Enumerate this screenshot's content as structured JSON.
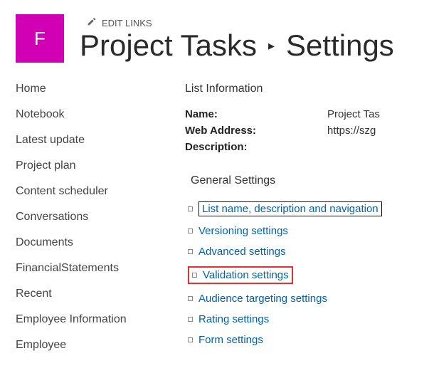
{
  "site": {
    "initial": "F"
  },
  "header": {
    "edit_links_label": "EDIT LINKS",
    "title_part1": "Project Tasks",
    "title_part2": "Settings"
  },
  "sidebar": {
    "items": [
      {
        "label": "Home"
      },
      {
        "label": "Notebook"
      },
      {
        "label": "Latest update"
      },
      {
        "label": "Project plan"
      },
      {
        "label": "Content scheduler"
      },
      {
        "label": "Conversations"
      },
      {
        "label": "Documents"
      },
      {
        "label": "FinancialStatements"
      },
      {
        "label": "Recent"
      },
      {
        "label": "Employee Information"
      },
      {
        "label": "Employee"
      }
    ]
  },
  "main": {
    "list_info_heading": "List Information",
    "name_label": "Name:",
    "name_value": "Project Tas",
    "webaddr_label": "Web Address:",
    "webaddr_value": "https://szg",
    "description_label": "Description:",
    "general_settings_heading": "General Settings",
    "settings": [
      {
        "label": "List name, description and navigation"
      },
      {
        "label": "Versioning settings"
      },
      {
        "label": "Advanced settings"
      },
      {
        "label": "Validation settings"
      },
      {
        "label": "Audience targeting settings"
      },
      {
        "label": "Rating settings"
      },
      {
        "label": "Form settings"
      }
    ]
  }
}
